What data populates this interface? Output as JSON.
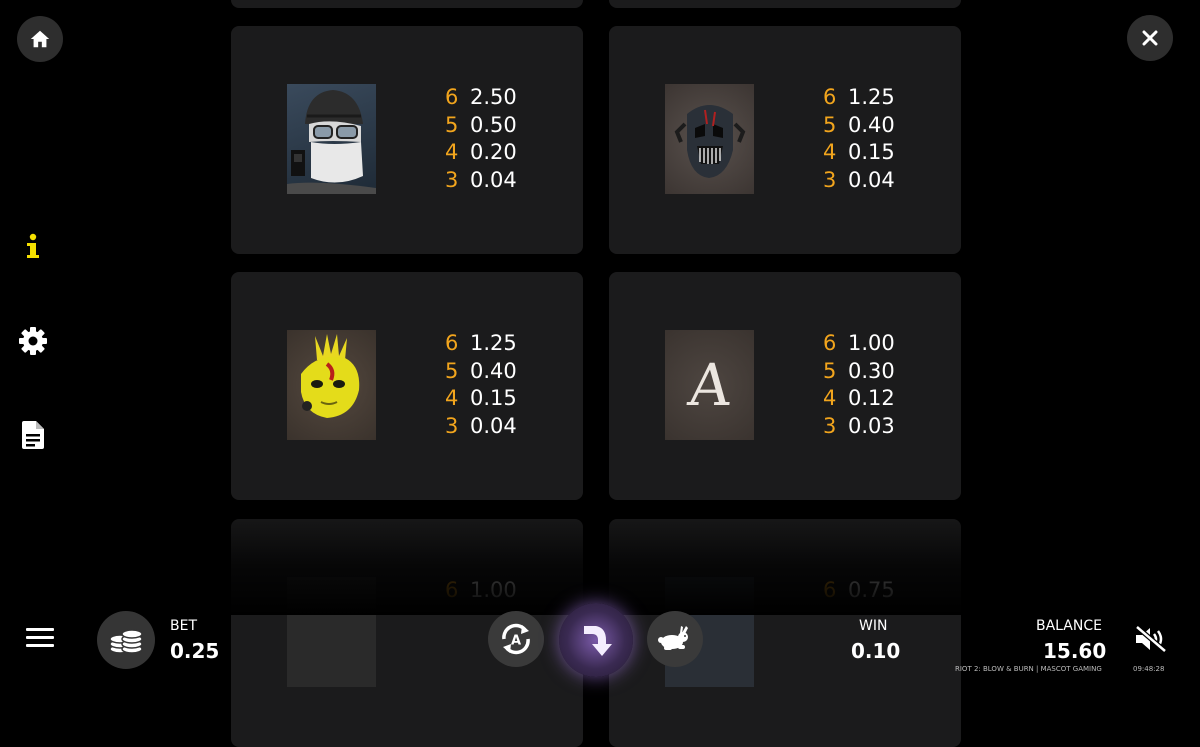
{
  "paytable": {
    "cards": [
      {
        "symbol": "robber-goggles",
        "pays": [
          {
            "count": "6",
            "value": "2.50"
          },
          {
            "count": "5",
            "value": "0.50"
          },
          {
            "count": "4",
            "value": "0.20"
          },
          {
            "count": "3",
            "value": "0.04"
          }
        ]
      },
      {
        "symbol": "dark-skull-mask",
        "pays": [
          {
            "count": "6",
            "value": "1.25"
          },
          {
            "count": "5",
            "value": "0.40"
          },
          {
            "count": "4",
            "value": "0.15"
          },
          {
            "count": "3",
            "value": "0.04"
          }
        ]
      },
      {
        "symbol": "yellow-spiked-mask",
        "pays": [
          {
            "count": "6",
            "value": "1.25"
          },
          {
            "count": "5",
            "value": "0.40"
          },
          {
            "count": "4",
            "value": "0.15"
          },
          {
            "count": "3",
            "value": "0.04"
          }
        ]
      },
      {
        "symbol": "letter-a",
        "pays": [
          {
            "count": "6",
            "value": "1.00"
          },
          {
            "count": "5",
            "value": "0.30"
          },
          {
            "count": "4",
            "value": "0.12"
          },
          {
            "count": "3",
            "value": "0.03"
          }
        ]
      },
      {
        "symbol": "partial-symbol",
        "pays": [
          {
            "count": "6",
            "value": "1.00"
          }
        ]
      },
      {
        "symbol": "partial-symbol",
        "pays": [
          {
            "count": "6",
            "value": "0.75"
          }
        ]
      }
    ]
  },
  "symbols": {
    "letter_a": "A"
  },
  "bottom_bar": {
    "bet_label": "BET",
    "bet_value": "0.25",
    "win_label": "WIN",
    "win_value": "0.10",
    "balance_label": "BALANCE",
    "balance_value": "15.60",
    "game_info": "RIOT 2: BLOW & BURN | MASCOT GAMING",
    "clock": "09:48:28",
    "autoplay_letter": "A"
  },
  "colors": {
    "accent_yellow": "#f2a51d",
    "info_icon": "#f5e000",
    "card_bg": "#1b1b1c",
    "spin_glow": "#a77be8"
  },
  "icons": {
    "home": "home-icon",
    "close": "close-icon",
    "info": "info-icon",
    "settings": "gear-icon",
    "rules": "document-icon",
    "menu": "hamburger-menu-icon",
    "bet": "coin-stack-icon",
    "autoplay": "autoplay-icon",
    "spin": "spin-arrow-icon",
    "turbo": "rabbit-icon",
    "sound": "sound-muted-icon"
  }
}
